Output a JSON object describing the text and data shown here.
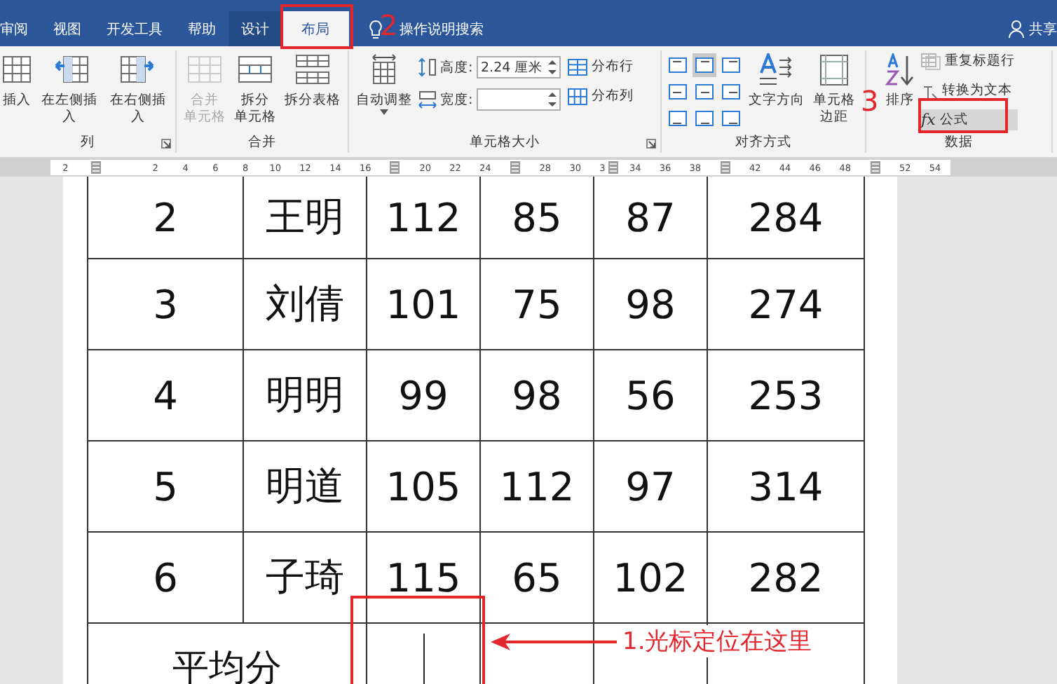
{
  "tabs": [
    {
      "label": "审阅",
      "selected": false,
      "kind": "plain"
    },
    {
      "label": "视图",
      "selected": false,
      "kind": "plain"
    },
    {
      "label": "开发工具",
      "selected": false,
      "kind": "plain"
    },
    {
      "label": "帮助",
      "selected": false,
      "kind": "plain"
    },
    {
      "label": "设计",
      "selected": false,
      "kind": "context"
    },
    {
      "label": "布局",
      "selected": true,
      "kind": "context"
    }
  ],
  "search": {
    "label": "操作说明搜索"
  },
  "account": {
    "label": "共享"
  },
  "ribbon": [
    {
      "label": "列",
      "launcher": true,
      "items": [
        {
          "kind": "big",
          "label": "插入",
          "disabled": false
        },
        {
          "kind": "big",
          "label": "在左侧插入",
          "disabled": false
        },
        {
          "kind": "big",
          "label": "在右侧插入",
          "disabled": false
        }
      ]
    },
    {
      "label": "合并",
      "launcher": false,
      "items": [
        {
          "kind": "big",
          "lines": [
            "合并",
            "单元格"
          ],
          "disabled": true
        },
        {
          "kind": "big",
          "lines": [
            "拆分",
            "单元格"
          ],
          "disabled": false
        },
        {
          "kind": "big",
          "label": "拆分表格",
          "disabled": false
        }
      ]
    },
    {
      "label": "单元格大小",
      "launcher": true,
      "items": [
        {
          "kind": "big",
          "label": "自动调整",
          "disabled": false,
          "dropdown": true
        },
        {
          "kind": "fields",
          "fields": [
            {
              "label": "高度:",
              "value": "2.24 厘米"
            },
            {
              "label": "宽度:"
            }
          ]
        },
        {
          "kind": "smalls",
          "buttons": [
            {
              "label": "分布行",
              "disabled": false,
              "selected": false
            },
            {
              "label": "分布列",
              "disabled": false,
              "selected": false
            }
          ]
        }
      ]
    },
    {
      "label": "对齐方式",
      "launcher": false,
      "items": [
        {
          "kind": "grid",
          "cells": [
            {
              "selected": false
            },
            {
              "selected": true
            },
            {
              "selected": false
            },
            {
              "selected": false
            },
            {
              "selected": false
            },
            {
              "selected": false
            },
            {
              "selected": false
            },
            {
              "selected": false
            },
            {
              "selected": false
            }
          ]
        },
        {
          "kind": "big",
          "label": "文字方向",
          "disabled": false
        },
        {
          "kind": "big",
          "lines": [
            "单元格",
            "边距"
          ],
          "disabled": false
        }
      ]
    },
    {
      "label": "数据",
      "launcher": false,
      "items": [
        {
          "kind": "big",
          "label": "排序",
          "disabled": false
        },
        {
          "kind": "smalls",
          "buttons": [
            {
              "label": "重复标题行",
              "disabled": true,
              "selected": false
            },
            {
              "label": "转换为文本",
              "disabled": false,
              "selected": false
            },
            {
              "label": "公式",
              "glyph": "fx",
              "disabled": false,
              "selected": true
            }
          ]
        }
      ]
    }
  ],
  "ruler": [
    {
      "kind": "num",
      "text": "2"
    },
    {
      "kind": "marker"
    },
    {
      "kind": "gap"
    },
    {
      "kind": "num",
      "text": "2"
    },
    {
      "kind": "num",
      "text": "4"
    },
    {
      "kind": "num",
      "text": "6"
    },
    {
      "kind": "num",
      "text": "8"
    },
    {
      "kind": "num",
      "text": "10"
    },
    {
      "kind": "num",
      "text": "12"
    },
    {
      "kind": "num",
      "text": "14"
    },
    {
      "kind": "num",
      "text": "16"
    },
    {
      "kind": "marker"
    },
    {
      "kind": "num",
      "text": "20"
    },
    {
      "kind": "num",
      "text": "22"
    },
    {
      "kind": "num",
      "text": "24"
    },
    {
      "kind": "marker"
    },
    {
      "kind": "num",
      "text": "28"
    },
    {
      "kind": "num",
      "text": "30"
    },
    {
      "kind": "lead",
      "text": "3"
    },
    {
      "kind": "half"
    },
    {
      "kind": "num",
      "text": "34"
    },
    {
      "kind": "num",
      "text": "36"
    },
    {
      "kind": "num",
      "text": "38"
    },
    {
      "kind": "marker"
    },
    {
      "kind": "num",
      "text": "42"
    },
    {
      "kind": "num",
      "text": "44"
    },
    {
      "kind": "num",
      "text": "46"
    },
    {
      "kind": "num",
      "text": "48"
    },
    {
      "kind": "marker"
    },
    {
      "kind": "num",
      "text": "52"
    },
    {
      "kind": "num",
      "text": "54"
    }
  ],
  "table": {
    "rows": [
      [
        "2",
        "王明",
        "112",
        "85",
        "87",
        "284"
      ],
      [
        "3",
        "刘倩",
        "101",
        "75",
        "98",
        "274"
      ],
      [
        "4",
        "明明",
        "99",
        "98",
        "56",
        "253"
      ],
      [
        "5",
        "明道",
        "105",
        "112",
        "97",
        "314"
      ],
      [
        "6",
        "子琦",
        "115",
        "65",
        "102",
        "282"
      ]
    ],
    "footer": {
      "label": "平均分"
    }
  },
  "annotations": [
    {
      "kind": "box"
    },
    {
      "kind": "step",
      "text": "2"
    },
    {
      "kind": "step",
      "text": "3"
    },
    {
      "kind": "box"
    },
    {
      "kind": "box"
    },
    {
      "kind": "callout",
      "text": "1.光标定位在这里"
    }
  ]
}
